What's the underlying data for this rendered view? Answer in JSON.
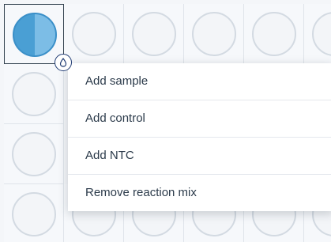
{
  "plate": {
    "well_icon": "circle",
    "selected_well_fill": [
      "#4a9fd4",
      "#7cbde6"
    ]
  },
  "badge": {
    "icon": "droplet-icon"
  },
  "context_menu": {
    "items": [
      {
        "label": "Add sample"
      },
      {
        "label": "Add control"
      },
      {
        "label": "Add NTC"
      },
      {
        "label": "Remove reaction mix"
      }
    ]
  }
}
